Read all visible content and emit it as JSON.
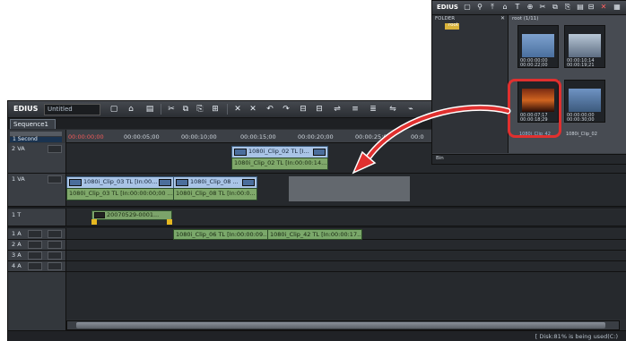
{
  "main": {
    "app_name": "EDIUS",
    "project_name": "Untitled",
    "sequence_tab": "Sequence1",
    "zoom_label": "1 Second",
    "ruler_ticks": [
      "00:00:00;00",
      "00:00:05;00",
      "00:00:10;00",
      "00:00:15;00",
      "00:00:20;00",
      "00:00:25;00",
      "00:0"
    ],
    "tracks": {
      "v2": "2 VA",
      "v1": "1 VA",
      "t1": "1 T",
      "a1": "1 A",
      "a2": "2 A",
      "a3": "3 A",
      "a4": "4 A"
    },
    "clips": {
      "v2_clip_top": "1080i_Clip_02  TL [I...",
      "v2_clip_bottom": "1080i_Clip_02  TL [In:00:00:14...",
      "v1_clip3_top": "1080i_Clip_03  TL [In:00...",
      "v1_clip3_bottom": "1080i_Clip_03  TL [In:00:00:00;00 ...",
      "v1_clip8_top": "1080i_Clip_08  ...",
      "v1_clip8_bottom": "1080i_Clip_08  TL [In:00:0...",
      "title_clip": "20070529-0001...",
      "a1_clip6": "1080i_Clip_06  TL [In:00:00:09...",
      "a1_clip42": "1080i_Clip_42  TL [In:00:00:17..."
    },
    "status_text": "[ Disk:81% is being used(C:)",
    "accent_color": "#e0302f"
  },
  "bin": {
    "app_name": "EDIUS",
    "folder_header": "FOLDER",
    "root_folder": "root",
    "path": "root (1/11)",
    "bin_label": "Bin",
    "thumbs": [
      {
        "label": "00:00:00;00\n00:00:22;00",
        "caption": ""
      },
      {
        "label": "00:00:10;14\n00:00:19;21",
        "caption": "1080i_Clip_06"
      },
      {
        "label": "00:00:07;17\n00:00:18;29",
        "caption": "1080i_Clip_42"
      },
      {
        "label": "00:00:00;00\n00:00:30;00",
        "caption": "1080i_Clip_02"
      }
    ]
  }
}
